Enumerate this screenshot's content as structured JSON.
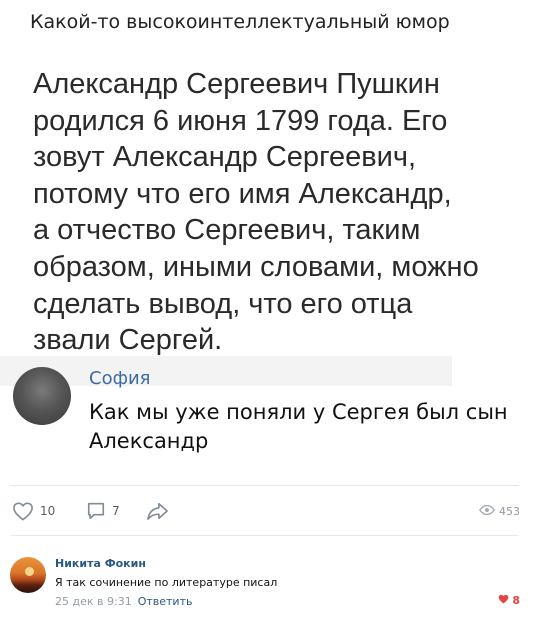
{
  "post": {
    "title": "Какой-то высокоинтеллектуальный юмор",
    "body_lines": [
      "Александр Сергеевич Пушкин",
      "родился 6 июня 1799 года. Его",
      "зовут Александр Сергеевич,",
      "потому что его имя Александр,",
      "а отчество Сергеевич, таким",
      "образом, иными словами, можно",
      "сделать вывод, что его отца",
      "звали Сергей."
    ],
    "quote": {
      "author": "София",
      "text_lines": [
        "Как мы уже поняли у Сергея был сын",
        "Александр"
      ]
    }
  },
  "actions": {
    "likes": "10",
    "comments": "7",
    "views": "453"
  },
  "comment": {
    "author": "Никита Фокин",
    "text": "Я так сочинение по литературе писал",
    "date": "25 дек в 9:31",
    "reply_label": "Ответить",
    "likes": "8"
  },
  "colors": {
    "link": "#2a5885",
    "quote_name": "#3e6c9e",
    "icon": "#818c99",
    "liked": "#e64646"
  }
}
